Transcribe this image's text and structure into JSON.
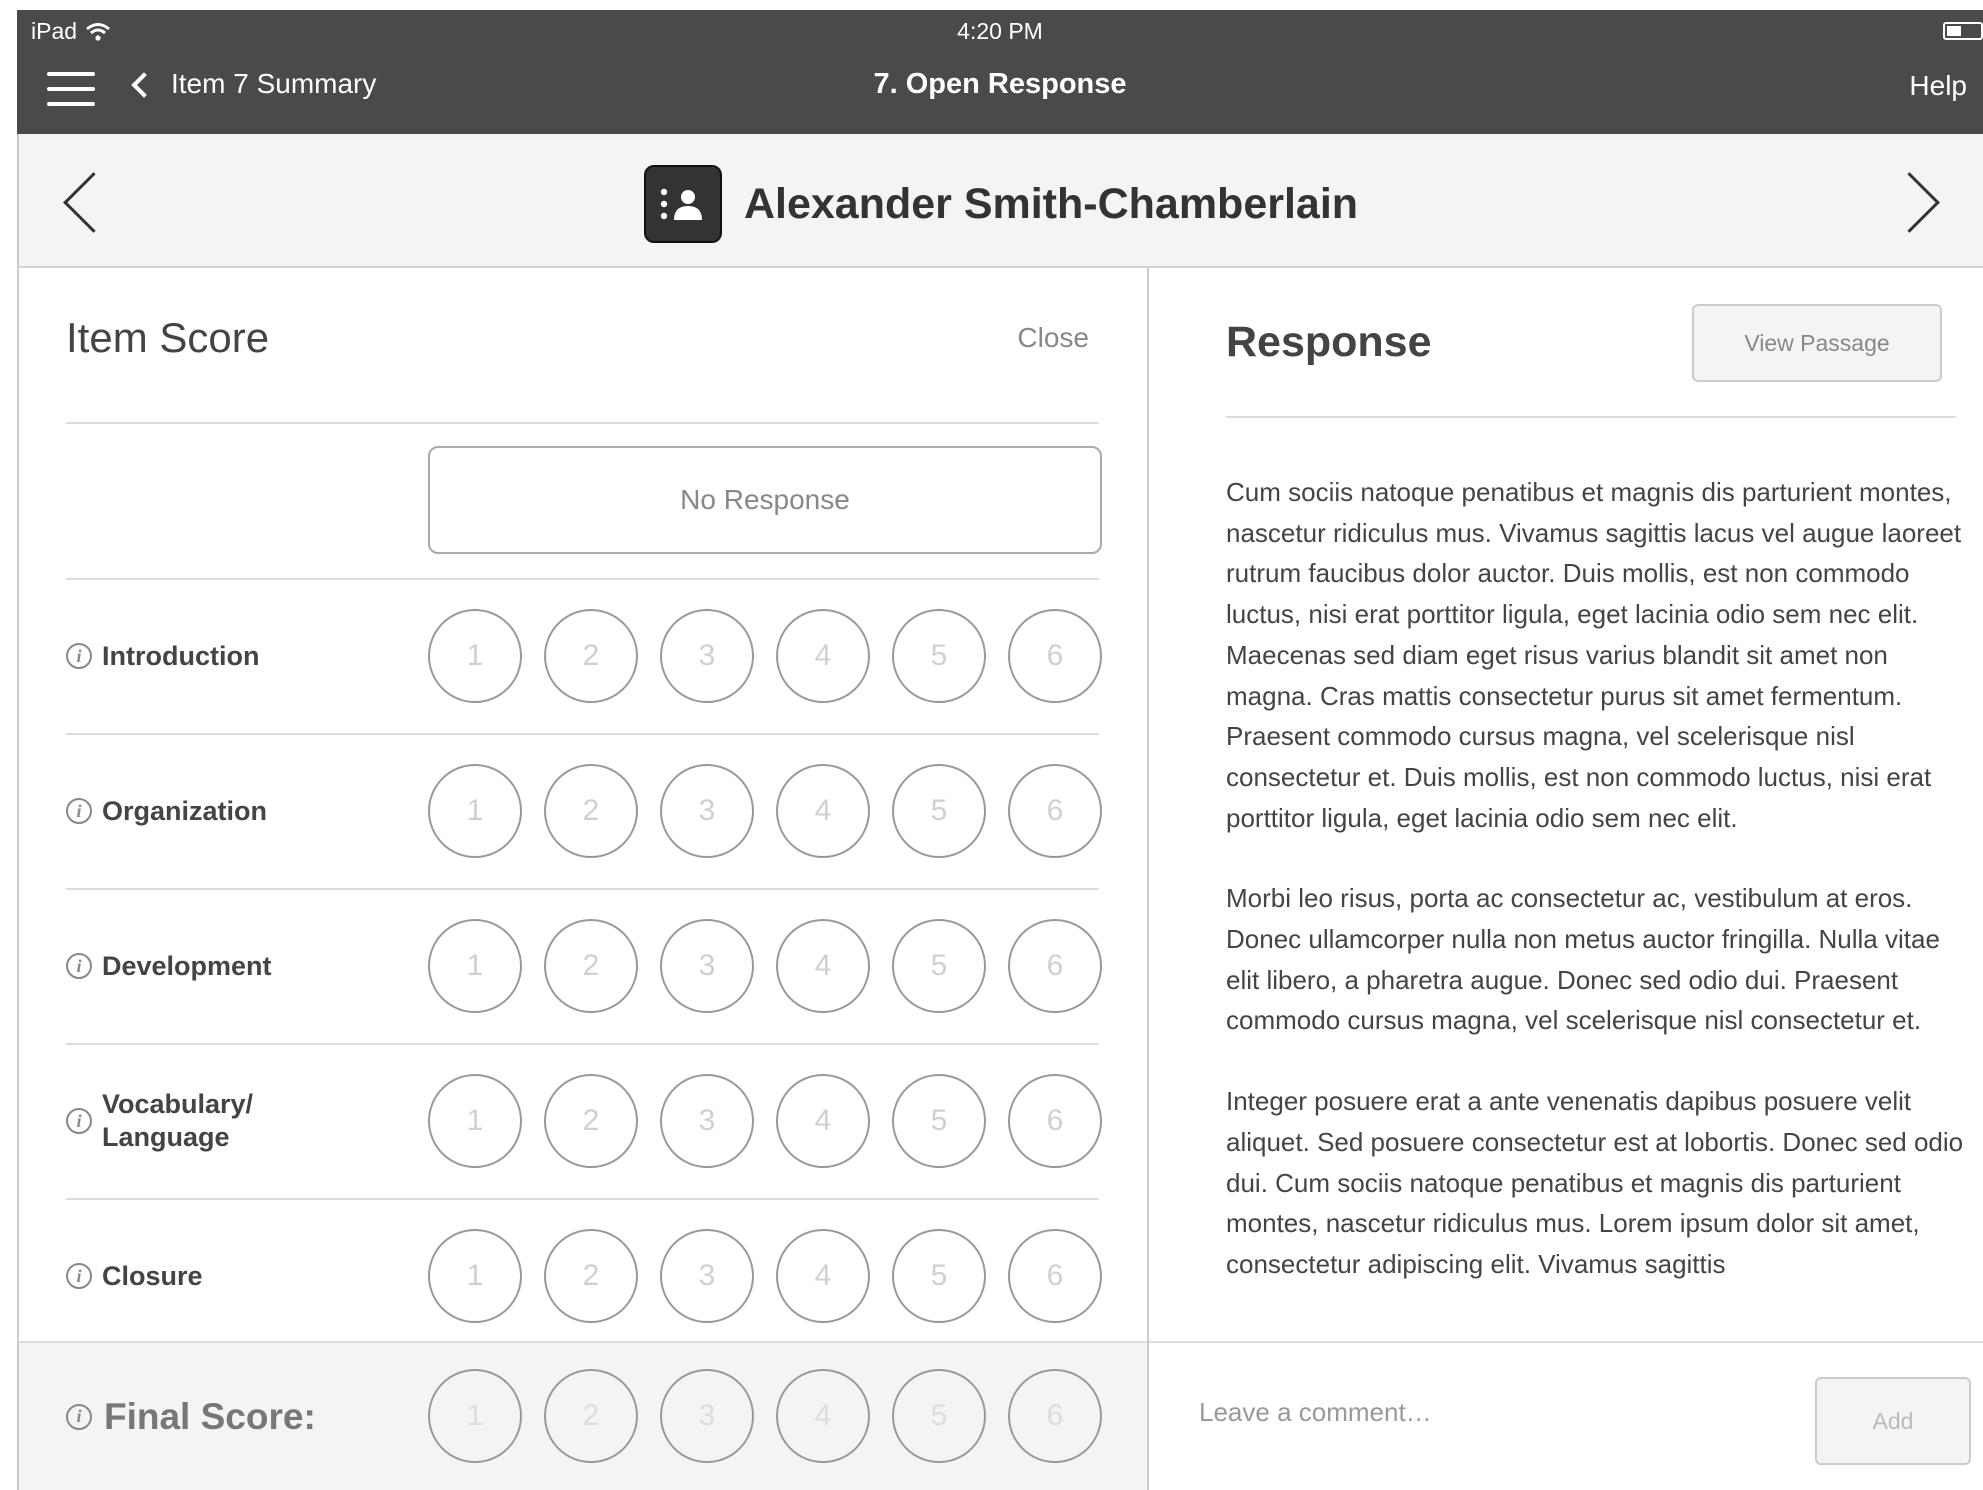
{
  "status_bar": {
    "carrier": "iPad",
    "time": "4:20 PM"
  },
  "navbar": {
    "back_label": "Item 7 Summary",
    "title": "7. Open Response",
    "help_label": "Help"
  },
  "student": {
    "name": "Alexander Smith-Chamberlain"
  },
  "item_score": {
    "title": "Item Score",
    "close_label": "Close",
    "no_response_label": "No Response",
    "score_options": [
      "1",
      "2",
      "3",
      "4",
      "5",
      "6"
    ],
    "criteria": [
      {
        "label": "Introduction"
      },
      {
        "label": "Organization"
      },
      {
        "label": "Development"
      },
      {
        "label": "Vocabulary/ Language",
        "line1": "Vocabulary/",
        "line2": "Language"
      },
      {
        "label": "Closure"
      }
    ],
    "final_label": "Final Score:"
  },
  "response": {
    "title": "Response",
    "view_passage_label": "View Passage",
    "paragraphs": [
      "Cum sociis natoque penatibus et magnis dis parturient montes, nascetur ridiculus mus. Vivamus sagittis lacus vel augue laoreet rutrum faucibus dolor auctor. Duis mollis, est non commodo luctus, nisi erat porttitor ligula, eget lacinia odio sem nec elit. Maecenas sed diam eget risus varius blandit sit amet non magna. Cras mattis consectetur purus sit amet fermentum. Praesent commodo cursus magna, vel scelerisque nisl consectetur et. Duis mollis, est non commodo luctus, nisi erat porttitor ligula, eget lacinia odio sem nec elit.",
      "Morbi leo risus, porta ac consectetur ac, vestibulum at eros. Donec ullamcorper nulla non metus auctor fringilla. Nulla vitae elit libero, a pharetra augue. Donec sed odio dui. Praesent commodo cursus magna, vel scelerisque nisl consectetur et.",
      "Integer posuere erat a ante venenatis dapibus posuere velit aliquet. Sed posuere consectetur est at lobortis. Donec sed odio dui. Cum sociis natoque penatibus et magnis dis parturient montes, nascetur ridiculus mus. Lorem ipsum dolor sit amet, consectetur adipiscing elit. Vivamus sagittis"
    ],
    "comment_placeholder": "Leave a comment…",
    "add_label": "Add"
  }
}
